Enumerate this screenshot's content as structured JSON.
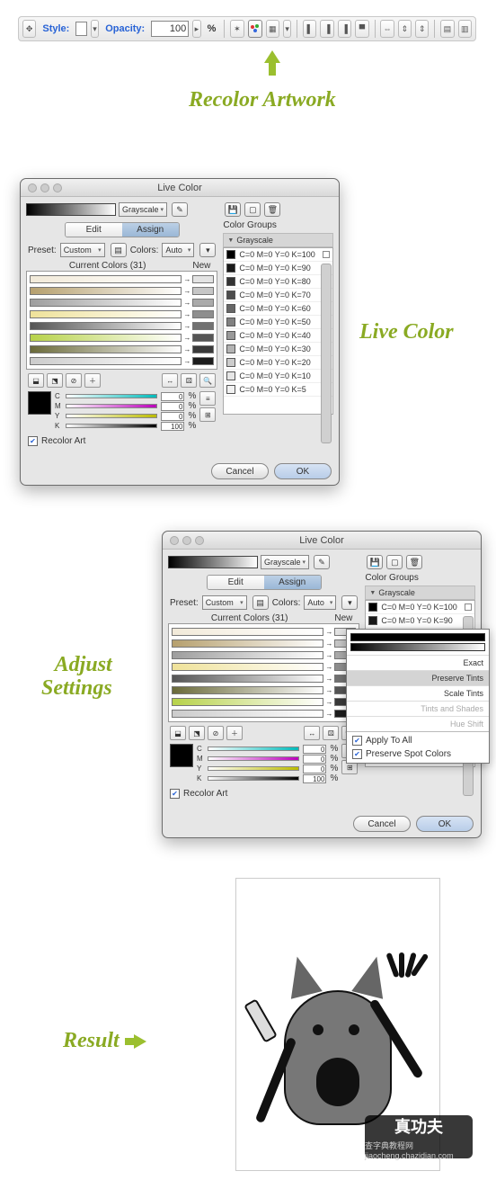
{
  "topbar": {
    "style_label": "Style:",
    "opacity_label": "Opacity:",
    "opacity_value": "100",
    "opacity_unit": "%"
  },
  "headings": {
    "recolor": "Recolor Artwork",
    "live": "Live Color",
    "adjust_l1": "Adjust",
    "adjust_l2": "Settings",
    "result": "Result"
  },
  "dialog": {
    "title": "Live Color",
    "gradient_name": "Grayscale",
    "tabs": {
      "edit": "Edit",
      "assign": "Assign"
    },
    "preset_label": "Preset:",
    "preset_value": "Custom",
    "colors_label": "Colors:",
    "colors_value": "Auto",
    "current_header": "Current Colors (31)",
    "new_header": "New",
    "cmyk": {
      "c": "C",
      "m": "M",
      "y": "Y",
      "k": "K",
      "v_c": "0",
      "v_m": "0",
      "v_y": "0",
      "v_k": "100"
    },
    "recolor_chk": "Recolor Art",
    "cancel": "Cancel",
    "ok": "OK",
    "groups_label": "Color Groups",
    "group_name": "Grayscale",
    "group_items": [
      "C=0 M=0 Y=0 K=100",
      "C=0 M=0 Y=0 K=90",
      "C=0 M=0 Y=0 K=80",
      "C=0 M=0 Y=0 K=70",
      "C=0 M=0 Y=0 K=60",
      "C=0 M=0 Y=0 K=50",
      "C=0 M=0 Y=0 K=40",
      "C=0 M=0 Y=0 K=30",
      "C=0 M=0 Y=0 K=20",
      "C=0 M=0 Y=0 K=10",
      "C=0 M=0 Y=0 K=5"
    ],
    "group_items_short": [
      "C=0 M=0 Y=0 K=100",
      "C=0 M=0 Y=0 K=90",
      "C=0 M=0 Y=0 K=10",
      "C=0 M=0 Y=0 K=5"
    ],
    "swatch_colors": [
      "#f2ead9",
      "#b6a06e",
      "#9e9e9e",
      "#efe29a",
      "#555",
      "#b7d24a",
      "#6a6a3a",
      "#ccc"
    ],
    "swatch_colors2": [
      "#f2ead9",
      "#b6a06e",
      "#9e9e9e",
      "#efe29a",
      "#555",
      "#6a6a3a",
      "#b7d24a",
      "#ccc"
    ]
  },
  "popup": {
    "exact": "Exact",
    "preserve": "Preserve Tints",
    "scale": "Scale Tints",
    "shades": "Tints and Shades",
    "hue": "Hue Shift",
    "apply_all": "Apply To All",
    "preserve_spot": "Preserve Spot Colors"
  },
  "stamp": {
    "brand": "真功夫",
    "sub_cn": "查字典教程网",
    "sub_url": "jiaocheng.chazidian.com"
  }
}
